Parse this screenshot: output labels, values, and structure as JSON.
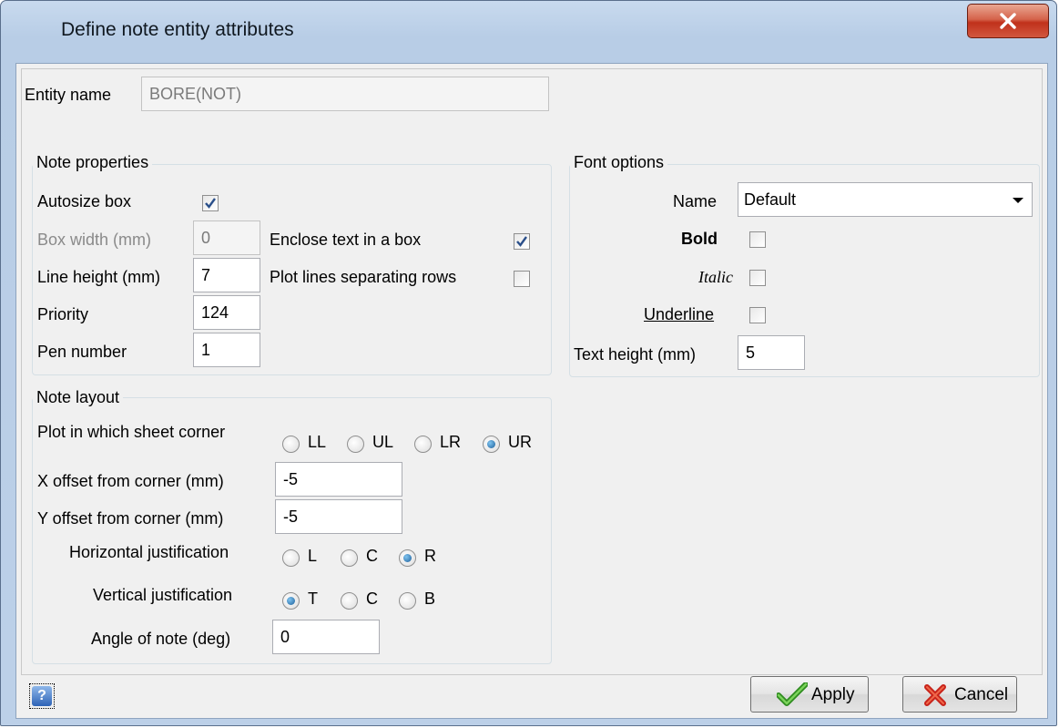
{
  "window": {
    "title": "Define note entity attributes"
  },
  "entity": {
    "label": "Entity name",
    "value": "BORE(NOT)"
  },
  "note_properties": {
    "title": "Note properties",
    "autosize_label": "Autosize box",
    "autosize_checked": true,
    "box_width_label": "Box width (mm)",
    "box_width_value": "0",
    "line_height_label": "Line height (mm)",
    "line_height_value": "7",
    "priority_label": "Priority",
    "priority_value": "124",
    "pen_label": "Pen number",
    "pen_value": "1",
    "enclose_label": "Enclose text in a box",
    "enclose_checked": true,
    "plot_lines_label": "Plot lines separating rows",
    "plot_lines_checked": false
  },
  "font_options": {
    "title": "Font options",
    "name_label": "Name",
    "name_value": "Default",
    "bold_label": "Bold",
    "italic_label": "Italic",
    "underline_label": "Underline",
    "text_height_label": "Text height (mm)",
    "text_height_value": "5"
  },
  "note_layout": {
    "title": "Note layout",
    "corner_label": "Plot in which sheet corner",
    "corner_options": [
      "LL",
      "UL",
      "LR",
      "UR"
    ],
    "corner_selected": "UR",
    "x_offset_label": "X offset from corner (mm)",
    "x_offset_value": "-5",
    "y_offset_label": "Y offset from corner (mm)",
    "y_offset_value": "-5",
    "hjust_label": "Horizontal justification",
    "hjust_options": [
      "L",
      "C",
      "R"
    ],
    "hjust_selected": "R",
    "vjust_label": "Vertical justification",
    "vjust_options": [
      "T",
      "C",
      "B"
    ],
    "vjust_selected": "T",
    "angle_label": "Angle of note (deg)",
    "angle_value": "0"
  },
  "buttons": {
    "apply": "Apply",
    "cancel": "Cancel",
    "help": "?"
  }
}
